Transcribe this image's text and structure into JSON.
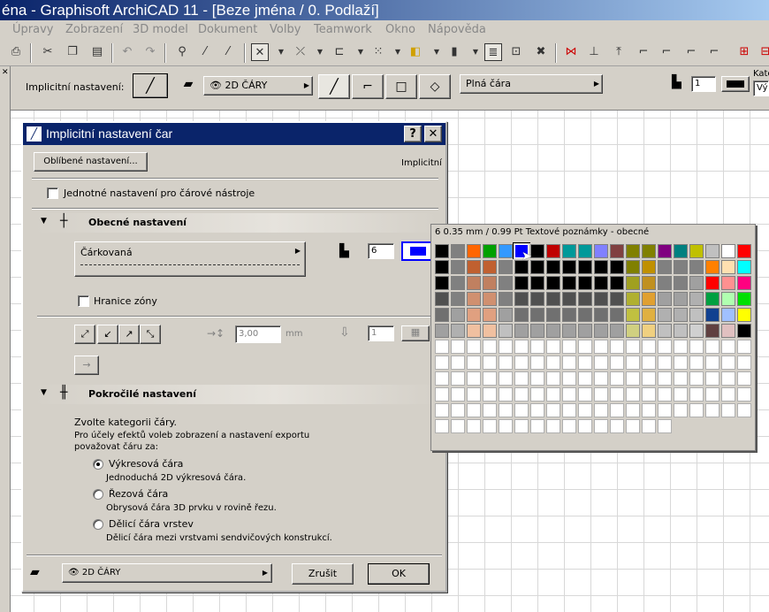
{
  "window": {
    "title": "éna - Graphisoft ArchiCAD 11 - [Beze jména / 0. Podlaží]"
  },
  "menu": [
    "Úpravy",
    "Zobrazení",
    "3D model",
    "Dokument",
    "Volby",
    "Teamwork",
    "Okno",
    "Nápověda"
  ],
  "infobox": {
    "label": "Implicitní nastavení:",
    "layer": "2D ČÁRY",
    "linetype": "Plná čára",
    "pen": "1",
    "category_label": "Kate",
    "category_value": "Vý"
  },
  "dialog": {
    "title": "Implicitní nastavení čar",
    "fav_button": "Oblíbené nastavení...",
    "implicit_label": "Implicitní",
    "uniform_check": "Jednotné nastavení pro čárové nástroje",
    "general_section": "Obecné nastavení",
    "linetype": "Čárkovaná",
    "pen_value": "6",
    "zone_border": "Hranice zóny",
    "arrow_size": "3,00",
    "arrow_unit": "mm",
    "arrow_pen": "1",
    "advanced_section": "Pokročilé nastavení",
    "category_intro": "Zvolte kategorii čáry.",
    "category_desc1": "Pro účely efektů voleb zobrazení a nastavení exportu",
    "category_desc2": "považovat čáru za:",
    "options": [
      {
        "label": "Výkresová čára",
        "desc": "Jednoduchá 2D výkresová čára.",
        "selected": true
      },
      {
        "label": "Řezová čára",
        "desc": "Obrysová čára 3D prvku v rovině řezu.",
        "selected": false
      },
      {
        "label": "Dělicí čára vrstev",
        "desc": "Dělicí čára mezi vrstvami sendvičových konstrukcí.",
        "selected": false
      }
    ],
    "layer": "2D ČÁRY",
    "cancel": "Zrušit",
    "ok": "OK"
  },
  "palette": {
    "header": "6  0.35 mm /  0.99 Pt Textové poznámky - obecné",
    "rows": [
      [
        "#000000",
        "#808080",
        "#ff6600",
        "#00a000",
        "#3399ff",
        "#0000ff",
        "#000000",
        "#c00000",
        "#009999",
        "#009999",
        "#8080ff",
        "#804040",
        "#808000",
        "#808000",
        "#800080",
        "#008080",
        "#c0c000",
        "#c0c0c0",
        "#ffffff",
        "#ff0000"
      ],
      [
        "#000000",
        "#808080",
        "#c06030",
        "#c06030",
        "#808080",
        "#000000",
        "#000000",
        "#000000",
        "#000000",
        "#000000",
        "#000000",
        "#000000",
        "#808000",
        "#c09000",
        "#808080",
        "#808080",
        "#808080",
        "#ff8000",
        "#ffe0b0",
        "#00ffff"
      ],
      [
        "#000000",
        "#808080",
        "#c08060",
        "#c08060",
        "#808080",
        "#000000",
        "#000000",
        "#000000",
        "#000000",
        "#000000",
        "#000000",
        "#000000",
        "#a0a020",
        "#c09020",
        "#808080",
        "#808080",
        "#a0a0a0",
        "#ff0000",
        "#ff9090",
        "#ff0080"
      ],
      [
        "#505050",
        "#808080",
        "#d09070",
        "#d09070",
        "#808080",
        "#505050",
        "#505050",
        "#505050",
        "#505050",
        "#505050",
        "#505050",
        "#505050",
        "#b0b030",
        "#e0a030",
        "#a0a0a0",
        "#a0a0a0",
        "#b0b0b0",
        "#00a040",
        "#b0ffb0",
        "#00e000"
      ],
      [
        "#707070",
        "#a0a0a0",
        "#e0a080",
        "#e0a080",
        "#a0a0a0",
        "#707070",
        "#707070",
        "#707070",
        "#707070",
        "#707070",
        "#707070",
        "#707070",
        "#c0c040",
        "#e0b040",
        "#b0b0b0",
        "#b0b0b0",
        "#c0c0c0",
        "#104090",
        "#a0c0ff",
        "#ffff00"
      ],
      [
        "#a0a0a0",
        "#b0b0b0",
        "#f0c0a0",
        "#f0c0a0",
        "#c0c0c0",
        "#a0a0a0",
        "#a0a0a0",
        "#a0a0a0",
        "#a0a0a0",
        "#a0a0a0",
        "#a0a0a0",
        "#a0a0a0",
        "#d0d080",
        "#f0d080",
        "#c0c0c0",
        "#c0c0c0",
        "#d0d0d0",
        "#604040",
        "#e0c0c0",
        "#000000"
      ]
    ],
    "blank_rows": 6,
    "last_row_cells": 15
  }
}
